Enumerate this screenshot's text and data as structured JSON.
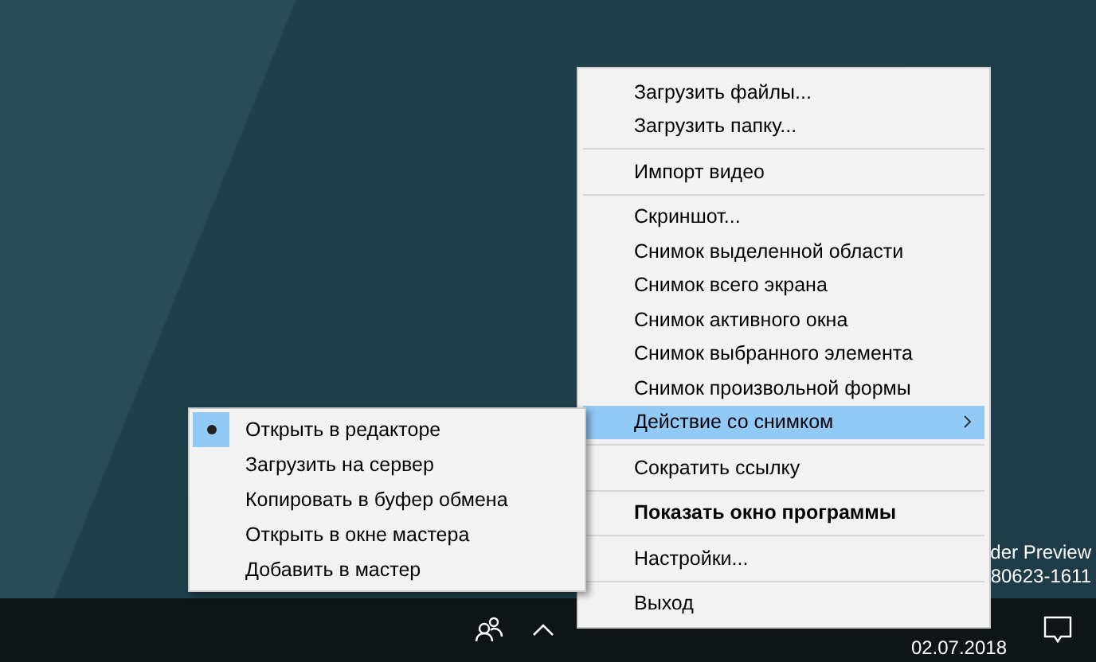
{
  "desktop": {
    "watermark_lines": [
      "der Preview",
      "80623-1611"
    ]
  },
  "context_menu": {
    "items": [
      {
        "kind": "item",
        "label": "Загрузить файлы...",
        "selected": false,
        "bold": false,
        "submenu": false
      },
      {
        "kind": "item",
        "label": "Загрузить папку...",
        "selected": false,
        "bold": false,
        "submenu": false
      },
      {
        "kind": "separator"
      },
      {
        "kind": "item",
        "label": "Импорт видео",
        "selected": false,
        "bold": false,
        "submenu": false
      },
      {
        "kind": "separator"
      },
      {
        "kind": "item",
        "label": "Скриншот...",
        "selected": false,
        "bold": false,
        "submenu": false
      },
      {
        "kind": "item",
        "label": "Снимок выделенной области",
        "selected": false,
        "bold": false,
        "submenu": false
      },
      {
        "kind": "item",
        "label": "Снимок всего экрана",
        "selected": false,
        "bold": false,
        "submenu": false
      },
      {
        "kind": "item",
        "label": "Снимок активного окна",
        "selected": false,
        "bold": false,
        "submenu": false
      },
      {
        "kind": "item",
        "label": "Снимок выбранного элемента",
        "selected": false,
        "bold": false,
        "submenu": false
      },
      {
        "kind": "item",
        "label": "Снимок произвольной формы",
        "selected": false,
        "bold": false,
        "submenu": false
      },
      {
        "kind": "item",
        "label": "Действие со снимком",
        "selected": true,
        "bold": false,
        "submenu": true
      },
      {
        "kind": "separator"
      },
      {
        "kind": "item",
        "label": "Сократить ссылку",
        "selected": false,
        "bold": false,
        "submenu": false
      },
      {
        "kind": "separator"
      },
      {
        "kind": "item",
        "label": "Показать окно программы",
        "selected": false,
        "bold": true,
        "submenu": false
      },
      {
        "kind": "separator"
      },
      {
        "kind": "item",
        "label": "Настройки...",
        "selected": false,
        "bold": false,
        "submenu": false
      },
      {
        "kind": "separator"
      },
      {
        "kind": "item",
        "label": "Выход",
        "selected": false,
        "bold": false,
        "submenu": false
      }
    ]
  },
  "submenu": {
    "items": [
      {
        "label": "Открыть в редакторе",
        "selected": true
      },
      {
        "label": "Загрузить на сервер",
        "selected": false
      },
      {
        "label": "Копировать в буфер обмена",
        "selected": false
      },
      {
        "label": "Открыть в окне мастера",
        "selected": false
      },
      {
        "label": "Добавить в мастер",
        "selected": false
      }
    ]
  },
  "taskbar": {
    "date": "02.07.2018"
  }
}
